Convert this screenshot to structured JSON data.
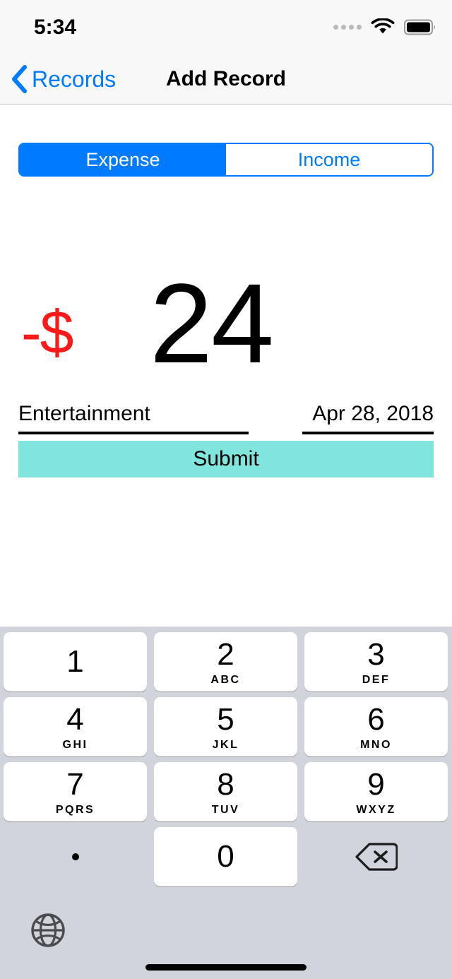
{
  "status_bar": {
    "time": "5:34",
    "signal_dots": 4,
    "wifi_icon": "wifi-icon",
    "battery_icon": "battery-full-icon"
  },
  "nav_bar": {
    "back_icon": "chevron-left-icon",
    "back_label": "Records",
    "title": "Add Record"
  },
  "segmented_control": {
    "options": [
      {
        "label": "Expense",
        "selected": true
      },
      {
        "label": "Income",
        "selected": false
      }
    ],
    "selected_color": "#007AFF",
    "unselected_text_color": "#007AFF"
  },
  "amount": {
    "sign": "-$",
    "value": "24",
    "sign_color": "#FF1A1A",
    "value_color": "#000000"
  },
  "fields": {
    "category": {
      "label": "category-field",
      "value": "Entertainment"
    },
    "date": {
      "label": "date-field",
      "value": "Apr 28, 2018"
    }
  },
  "submit": {
    "label": "Submit",
    "color": "#7FE5DD"
  },
  "keyboard": {
    "background_color": "#D1D5DB",
    "key_color": "#FFFFFF",
    "rows": [
      [
        {
          "digit": "1",
          "sub": ""
        },
        {
          "digit": "2",
          "sub": "ABC"
        },
        {
          "digit": "3",
          "sub": "DEF"
        }
      ],
      [
        {
          "digit": "4",
          "sub": "GHI"
        },
        {
          "digit": "5",
          "sub": "JKL"
        },
        {
          "digit": "6",
          "sub": "MNO"
        }
      ],
      [
        {
          "digit": "7",
          "sub": "PQRS"
        },
        {
          "digit": "8",
          "sub": "TUV"
        },
        {
          "digit": "9",
          "sub": "WXYZ"
        }
      ]
    ],
    "last_row": {
      "period": ".",
      "zero": {
        "digit": "0",
        "sub": ""
      },
      "backspace_icon": "backspace-icon"
    },
    "globe_icon": "globe-icon"
  },
  "home_indicator": "home-indicator"
}
